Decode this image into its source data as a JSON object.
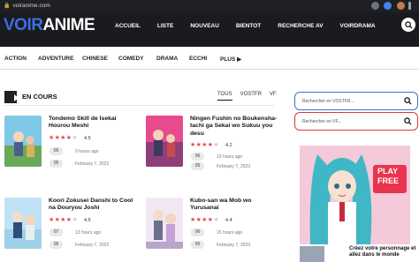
{
  "browser": {
    "url": "voiranime.com"
  },
  "header": {
    "logo_voir": "VOIR",
    "logo_anime": "ANIME",
    "nav": [
      "ACCUEIL",
      "LISTE",
      "NOUVEAU",
      "BIENTOT",
      "RECHERCHE AV",
      "VOIRDRAMA"
    ]
  },
  "genres": [
    "ACTION",
    "ADVENTURE",
    "CHINESE",
    "COMEDY",
    "DRAMA",
    "ECCHI",
    "PLUS"
  ],
  "section": {
    "title": "EN COURS",
    "tabs": [
      "TOUS",
      "VOSTFR",
      "VF"
    ]
  },
  "cards": [
    {
      "title": "Tondemo Skill de Isekai Hourou Meshi",
      "stars": 4.5,
      "rating": "4.5",
      "ep1": "06",
      "meta1": "9 hours ago",
      "ep2": "05",
      "meta2": "February 7, 2023"
    },
    {
      "title": "Ningen Fushin no Boukensha-tachi ga Sekai wo Sukuu you desu",
      "stars": 4.2,
      "rating": "4.2",
      "ep1": "06",
      "meta1": "12 hours ago",
      "ep2": "05",
      "meta2": "February 7, 2023"
    },
    {
      "title": "Koori Zokusei Danshi to Cool na Douryou Joshi",
      "stars": 4.5,
      "rating": "4.5",
      "ep1": "07",
      "meta1": "13 hours ago",
      "ep2": "06",
      "meta2": "February 7, 2023"
    },
    {
      "title": "Kubo-san wa Mob wo Yurusanai",
      "stars": 4.4,
      "rating": "4.4",
      "ep1": "06",
      "meta1": "15 hours ago",
      "ep2": "05",
      "meta2": "February 7, 2023"
    }
  ],
  "sidebar": {
    "search_vostfr_placeholder": "Rechercher en VOSTFR...",
    "search_vf_placeholder": "Rechercher en VF...",
    "ad_text_1": "PLAY",
    "ad_text_2": "FREE",
    "promo_text": "Créez votre personnage et allez dans le monde"
  },
  "colors": {
    "header_bg": "#1a1b1e",
    "logo_accent": "#3b6fe0",
    "star": "#e24b4b",
    "vostfr_border": "#3a6fd6",
    "vf_border": "#d93a3a"
  }
}
